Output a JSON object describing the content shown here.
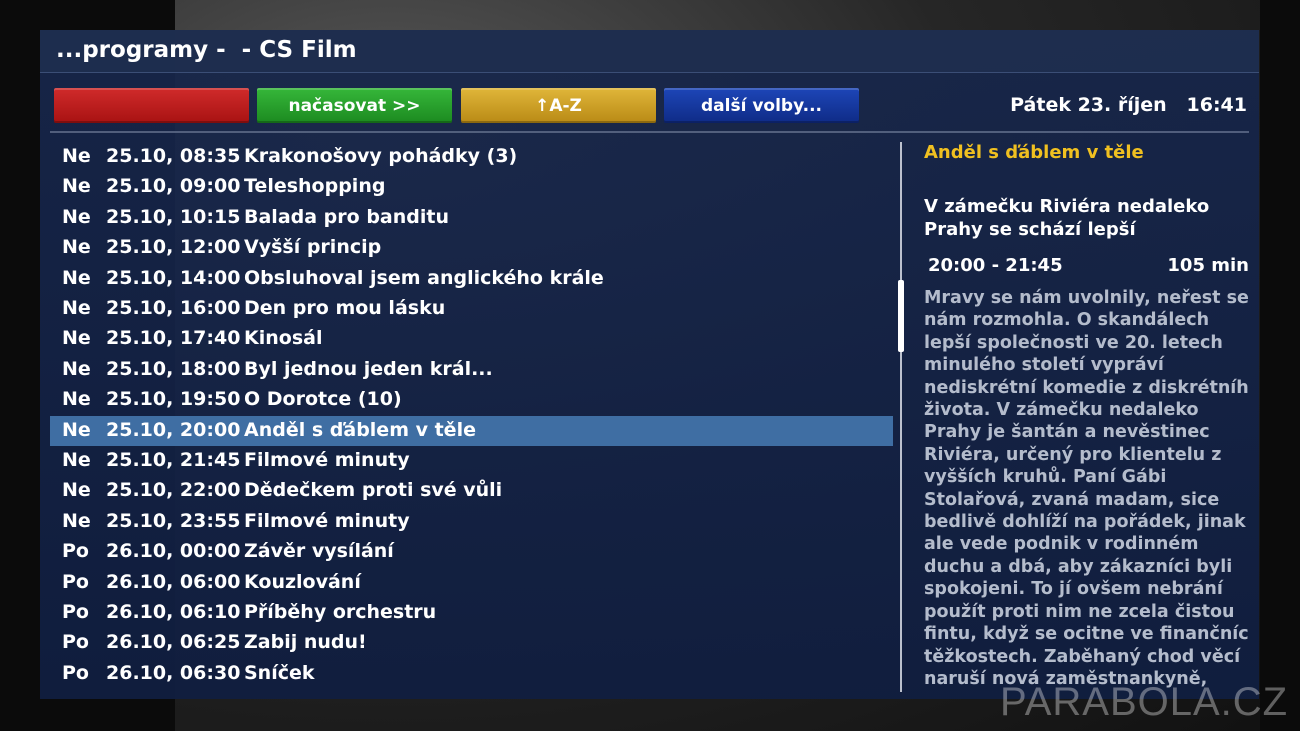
{
  "header": {
    "title": "...programy -  - CS Film"
  },
  "buttons": {
    "red": "",
    "green": "načasovat >>",
    "yellow": "↑A-Z",
    "blue": "další volby..."
  },
  "datetime": "Pátek 23. říjen   16:41",
  "programs": [
    {
      "day": "Ne",
      "time": "25.10, 08:35",
      "name": "Krakonošovy pohádky (3)"
    },
    {
      "day": "Ne",
      "time": "25.10, 09:00",
      "name": "Teleshopping"
    },
    {
      "day": "Ne",
      "time": "25.10, 10:15",
      "name": "Balada pro banditu"
    },
    {
      "day": "Ne",
      "time": "25.10, 12:00",
      "name": "Vyšší princip"
    },
    {
      "day": "Ne",
      "time": "25.10, 14:00",
      "name": "Obsluhoval jsem anglického krále"
    },
    {
      "day": "Ne",
      "time": "25.10, 16:00",
      "name": "Den pro mou lásku"
    },
    {
      "day": "Ne",
      "time": "25.10, 17:40",
      "name": "Kinosál"
    },
    {
      "day": "Ne",
      "time": "25.10, 18:00",
      "name": "Byl jednou jeden král..."
    },
    {
      "day": "Ne",
      "time": "25.10, 19:50",
      "name": "O Dorotce (10)"
    },
    {
      "day": "Ne",
      "time": "25.10, 20:00",
      "name": "Anděl s ďáblem v těle",
      "selected": true
    },
    {
      "day": "Ne",
      "time": "25.10, 21:45",
      "name": "Filmové minuty"
    },
    {
      "day": "Ne",
      "time": "25.10, 22:00",
      "name": "Dědečkem proti své vůli"
    },
    {
      "day": "Ne",
      "time": "25.10, 23:55",
      "name": "Filmové minuty"
    },
    {
      "day": "Po",
      "time": "26.10, 00:00",
      "name": "Závěr vysílání"
    },
    {
      "day": "Po",
      "time": "26.10, 06:00",
      "name": "Kouzlování"
    },
    {
      "day": "Po",
      "time": "26.10, 06:10",
      "name": "Příběhy orchestru"
    },
    {
      "day": "Po",
      "time": "26.10, 06:25",
      "name": "Zabij nudu!"
    },
    {
      "day": "Po",
      "time": "26.10, 06:30",
      "name": "Sníček"
    }
  ],
  "info": {
    "title": "Anděl s ďáblem v těle",
    "subtitle": "V zámečku Riviéra nedaleko Prahy se schází lepší",
    "time": "20:00 - 21:45",
    "duration": "105 min",
    "description_lines": [
      "Mravy se nám uvolnily, neřest se",
      "nám rozmohla. O skandálech",
      "lepší společnosti ve 20. letech",
      "minulého století vypráví",
      "nediskrétní komedie z diskrétního",
      "života. V zámečku nedaleko",
      "Prahy je šantán a nevěstinec",
      "Riviéra, určený pro klientelu z",
      "vyšších kruhů. Paní Gábi",
      "Stolařová, zvaná madam, sice",
      "bedlivě dohlíží na pořádek, jinak",
      "ale vede podnik v rodinném",
      "duchu a dbá, aby zákazníci byli",
      "spokojeni. To jí ovšem nebrání",
      "použít proti nim ne zcela čistou",
      "fintu, když se ocitne ve finančních",
      "těžkostech. Zaběhaný chod věcí",
      "naruší nová zaměstnankyně,"
    ]
  },
  "watermark": "PARABOLA.CZ"
}
